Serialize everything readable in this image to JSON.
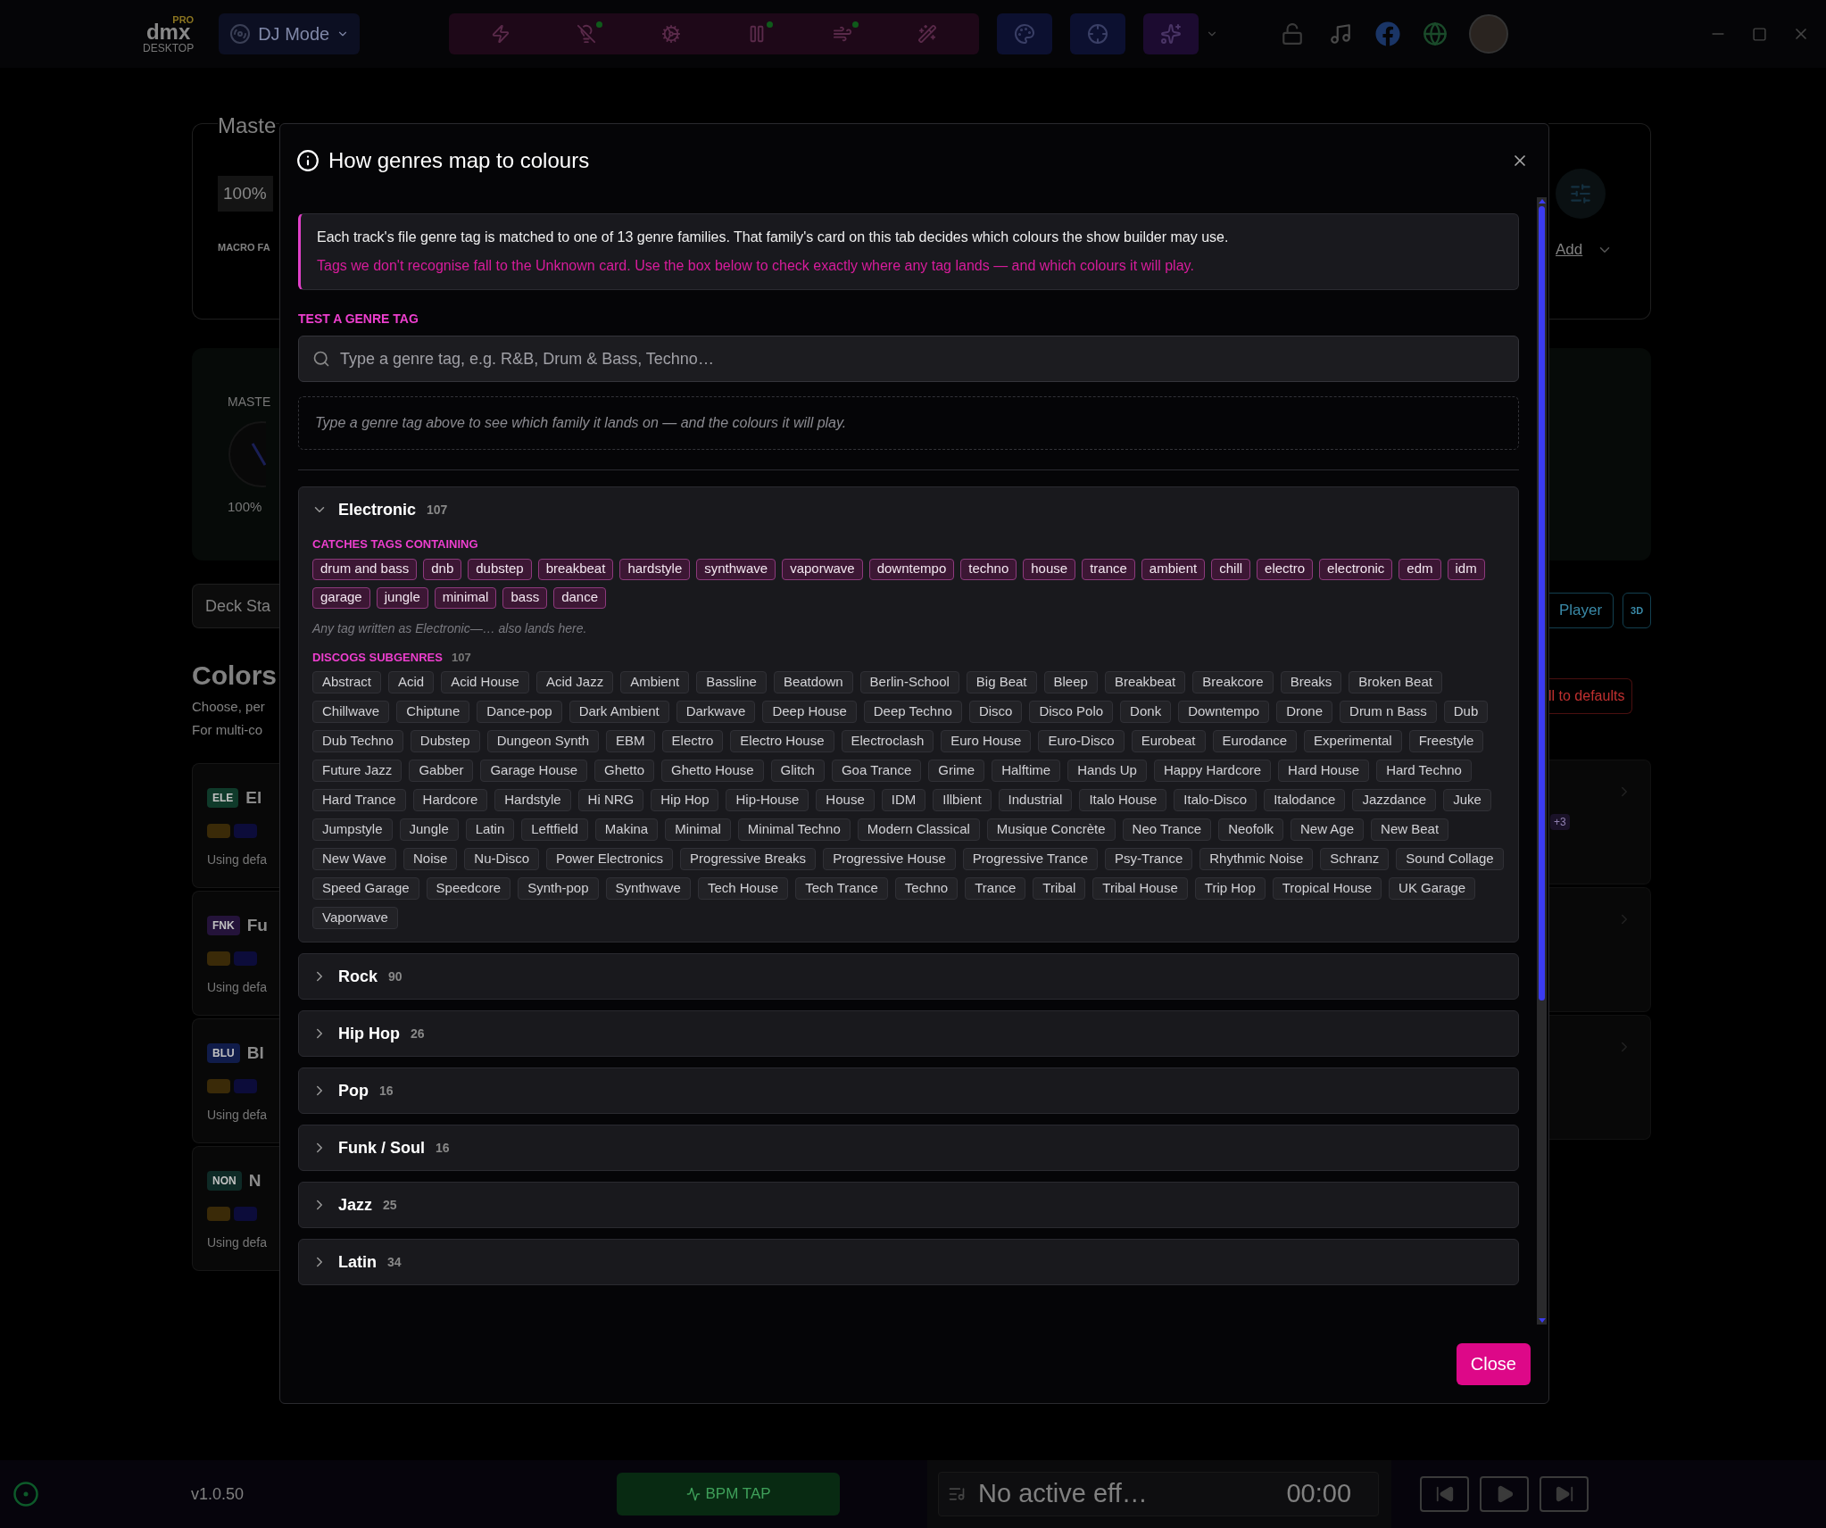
{
  "topbar": {
    "logo": {
      "badge": "PRO",
      "wordmark": "dmx",
      "subtitle": "DESKTOP"
    },
    "mode_button": "DJ Mode",
    "effect_buttons": [
      {
        "kind": "bolt",
        "active": false
      },
      {
        "kind": "bulb",
        "active": true
      },
      {
        "kind": "gear",
        "active": false
      },
      {
        "kind": "pause",
        "active": true
      },
      {
        "kind": "wind",
        "active": true
      },
      {
        "kind": "wand",
        "active": false
      }
    ]
  },
  "background": {
    "master_card": {
      "title": "Maste",
      "value": "100%",
      "label": "MACRO FA",
      "action": "Add"
    },
    "master_panel": {
      "label": "MASTE",
      "reading": "100%"
    },
    "deck_button": "Deck Sta",
    "player_button": "Player",
    "view_button": "3D",
    "colors": {
      "title": "Colors",
      "lines": [
        "Choose, per",
        "For multi-co"
      ],
      "reset_button": "ll to defaults",
      "cards": [
        {
          "tag": "ELE",
          "name": "El",
          "note": "Using defa",
          "color": "#0f3a2a",
          "extra": "+3"
        },
        {
          "tag": "FNK",
          "name": "Fu",
          "note": "Using defa",
          "color": "#24133a"
        },
        {
          "tag": "BLU",
          "name": "Bl",
          "note": "Using defa",
          "color": "#101c4a"
        },
        {
          "tag": "NON",
          "name": "N",
          "note": "Using defa",
          "color": "#0e2a26"
        }
      ]
    }
  },
  "modal": {
    "title": "How genres map to colours",
    "intro": {
      "text": "Each track's file genre tag is matched to one of 13 genre families. That family's card on this tab decides which colours the show builder may use.",
      "note": "Tags we don't recognise fall to the Unknown card. Use the box below to check exactly where any tag lands — and which colours it will play."
    },
    "test": {
      "label": "TEST A GENRE TAG",
      "placeholder": "Type a genre tag, e.g. R&B, Drum & Bass, Techno…",
      "hint": "Type a genre tag above to see which family it lands on — and the colours it will play."
    },
    "families": [
      {
        "name": "Electronic",
        "count": "107",
        "expanded": true,
        "catches_label": "CATCHES TAGS CONTAINING",
        "catches": [
          "drum and bass",
          "dnb",
          "dubstep",
          "breakbeat",
          "hardstyle",
          "synthwave",
          "vaporwave",
          "downtempo",
          "techno",
          "house",
          "trance",
          "ambient",
          "chill",
          "electro",
          "electronic",
          "edm",
          "idm",
          "garage",
          "jungle",
          "minimal",
          "bass",
          "dance"
        ],
        "alias_note": "Any tag written as Electronic—… also lands here.",
        "subgenres_label": "DISCOGS SUBGENRES",
        "subgenres_count": "107",
        "subgenres": [
          "Abstract",
          "Acid",
          "Acid House",
          "Acid Jazz",
          "Ambient",
          "Bassline",
          "Beatdown",
          "Berlin-School",
          "Big Beat",
          "Bleep",
          "Breakbeat",
          "Breakcore",
          "Breaks",
          "Broken Beat",
          "Chillwave",
          "Chiptune",
          "Dance-pop",
          "Dark Ambient",
          "Darkwave",
          "Deep House",
          "Deep Techno",
          "Disco",
          "Disco Polo",
          "Donk",
          "Downtempo",
          "Drone",
          "Drum n Bass",
          "Dub",
          "Dub Techno",
          "Dubstep",
          "Dungeon Synth",
          "EBM",
          "Electro",
          "Electro House",
          "Electroclash",
          "Euro House",
          "Euro-Disco",
          "Eurobeat",
          "Eurodance",
          "Experimental",
          "Freestyle",
          "Future Jazz",
          "Gabber",
          "Garage House",
          "Ghetto",
          "Ghetto House",
          "Glitch",
          "Goa Trance",
          "Grime",
          "Halftime",
          "Hands Up",
          "Happy Hardcore",
          "Hard House",
          "Hard Techno",
          "Hard Trance",
          "Hardcore",
          "Hardstyle",
          "Hi NRG",
          "Hip Hop",
          "Hip-House",
          "House",
          "IDM",
          "Illbient",
          "Industrial",
          "Italo House",
          "Italo-Disco",
          "Italodance",
          "Jazzdance",
          "Juke",
          "Jumpstyle",
          "Jungle",
          "Latin",
          "Leftfield",
          "Makina",
          "Minimal",
          "Minimal Techno",
          "Modern Classical",
          "Musique Concrète",
          "Neo Trance",
          "Neofolk",
          "New Age",
          "New Beat",
          "New Wave",
          "Noise",
          "Nu-Disco",
          "Power Electronics",
          "Progressive Breaks",
          "Progressive House",
          "Progressive Trance",
          "Psy-Trance",
          "Rhythmic Noise",
          "Schranz",
          "Sound Collage",
          "Speed Garage",
          "Speedcore",
          "Synth-pop",
          "Synthwave",
          "Tech House",
          "Tech Trance",
          "Techno",
          "Trance",
          "Tribal",
          "Tribal House",
          "Trip Hop",
          "Tropical House",
          "UK Garage",
          "Vaporwave"
        ]
      },
      {
        "name": "Rock",
        "count": "90",
        "expanded": false
      },
      {
        "name": "Hip Hop",
        "count": "26",
        "expanded": false
      },
      {
        "name": "Pop",
        "count": "16",
        "expanded": false
      },
      {
        "name": "Funk / Soul",
        "count": "16",
        "expanded": false
      },
      {
        "name": "Jazz",
        "count": "25",
        "expanded": false
      },
      {
        "name": "Latin",
        "count": "34",
        "expanded": false
      }
    ],
    "close_button": "Close"
  },
  "bottombar": {
    "version": "v1.0.50",
    "bpm_button": "BPM TAP",
    "now_playing": "No active eff…",
    "time": "00:00"
  }
}
